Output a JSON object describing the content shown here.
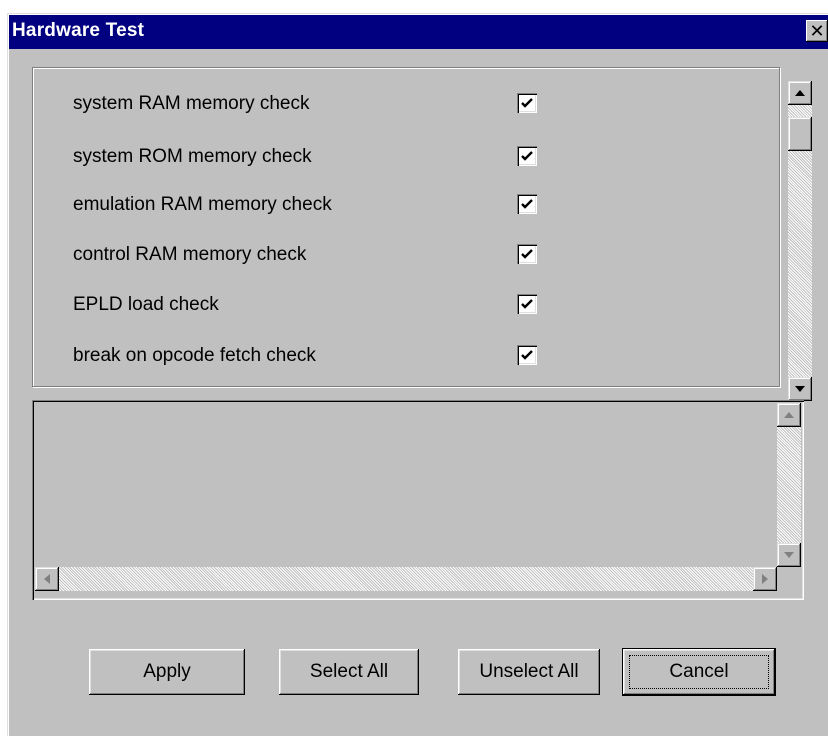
{
  "window": {
    "title": "Hardware Test",
    "close_label": "✕"
  },
  "tests": [
    {
      "label": "system RAM memory check",
      "checked": true
    },
    {
      "label": "system ROM memory check",
      "checked": true
    },
    {
      "label": "emulation RAM memory check",
      "checked": true
    },
    {
      "label": "control RAM memory check",
      "checked": true
    },
    {
      "label": "EPLD load check",
      "checked": true
    },
    {
      "label": "break on opcode fetch check",
      "checked": true
    }
  ],
  "output": {
    "text": ""
  },
  "buttons": {
    "apply": "Apply",
    "select_all": "Select All",
    "unselect_all": "Unselect All",
    "cancel": "Cancel"
  },
  "colors": {
    "titlebar": "#000080",
    "face": "#c0c0c0"
  }
}
